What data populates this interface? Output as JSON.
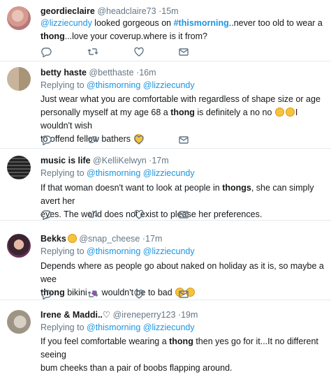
{
  "tweets": [
    {
      "name": "geordieclaire",
      "handle": "@headclaire73",
      "dot": "·",
      "time": "15m",
      "reply_prefix": "",
      "reply_users": "",
      "line1_a": "@lizziecundy",
      "line1_b": " looked gorgeous on ",
      "line1_c": "#thismorning",
      "line1_d": "..never too old to wear a",
      "line2_a": "thong",
      "line2_b": "...love your coverup.where is it from?"
    },
    {
      "name": "betty haste",
      "handle": "@betthaste",
      "dot": "·",
      "time": "16m",
      "reply_prefix": "Replying to ",
      "reply_users": "@thismorning @lizziecundy",
      "line1": "Just wear what you are comfortable with regardless of shape size or age",
      "line2_a": "personally myself at my age 68 a ",
      "line2_b": "thong",
      "line2_c": " is definitely a no no ",
      "line2_d": "I wouldn't wish",
      "line3": "to offend fellow bathers "
    },
    {
      "name": "music is life",
      "handle": "@KelliKelwyn",
      "dot": "·",
      "time": "17m",
      "reply_prefix": "Replying to ",
      "reply_users": "@thismorning @lizziecundy",
      "line1_a": "If that woman doesn't want to look at people in ",
      "line1_b": "thongs",
      "line1_c": ", she can simply avert her",
      "line2": "eyes. The world does not exist to please her preferences."
    },
    {
      "name": "Bekks",
      "handle": "@snap_cheese",
      "dot": "·",
      "time": "17m",
      "reply_prefix": "Replying to ",
      "reply_users": "@thismorning @lizziecundy",
      "line1": "Depends where as people go about naked on holiday as it is, so maybe a wee",
      "line2_a": "thong",
      "line2_b": " bikini ",
      "line2_c": " wouldn't be to bad "
    },
    {
      "name": "Irene & Maddi..♡",
      "handle": "@ireneperry123",
      "dot": "·",
      "time": "19m",
      "reply_prefix": "Replying to ",
      "reply_users": "@thismorning @lizziecundy",
      "line1_a": "If you feel comfortable wearing a ",
      "line1_b": "thong",
      "line1_c": " then yes go for it...It no different seeing",
      "line2": "bum cheeks than a pair of boobs flapping around."
    }
  ],
  "icons": {
    "reply": "reply-icon",
    "retweet": "retweet-icon",
    "like": "like-icon",
    "dm": "direct-message-icon"
  },
  "colors": {
    "link": "#1b95e0",
    "secondary": "#657786",
    "text": "#14171a",
    "divider": "#e6ecf0"
  }
}
